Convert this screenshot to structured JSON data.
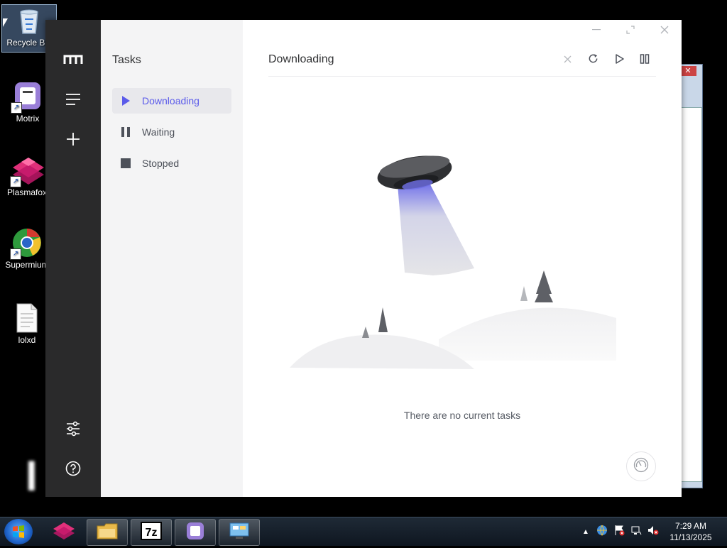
{
  "desktop": {
    "icons": [
      {
        "label": "Recycle Bin",
        "icon": "recycle-bin-icon"
      },
      {
        "label": "Motrix",
        "icon": "motrix-icon"
      },
      {
        "label": "Plasmafox",
        "icon": "plasmafox-icon"
      },
      {
        "label": "Supermium",
        "icon": "supermium-icon"
      },
      {
        "label": "lolxd",
        "icon": "document-icon"
      }
    ]
  },
  "app": {
    "rail": {
      "logo_icon": "motrix-logo-icon",
      "menu_icon": "menu-icon",
      "add_icon": "plus-icon",
      "settings_icon": "sliders-icon",
      "help_icon": "help-circle-icon"
    },
    "sidebar": {
      "title": "Tasks",
      "items": [
        {
          "label": "Downloading",
          "icon": "play-icon",
          "active": true
        },
        {
          "label": "Waiting",
          "icon": "pause-icon",
          "active": false
        },
        {
          "label": "Stopped",
          "icon": "stop-icon",
          "active": false
        }
      ]
    },
    "main": {
      "heading": "Downloading",
      "toolbar": [
        "close-icon",
        "refresh-icon",
        "play-icon",
        "pause-icon"
      ],
      "empty_message": "There are no current tasks"
    },
    "colors": {
      "rail_bg": "#2a2a2b",
      "sidebar_bg": "#f4f4f5",
      "accent": "#5b5bea"
    }
  },
  "taskbar": {
    "pinned": [
      "windows-start-icon",
      "plasmafox-icon",
      "file-explorer-icon",
      "7zip-icon",
      "motrix-icon",
      "control-panel-icon"
    ],
    "clock": {
      "time": "7:29 AM",
      "date": "11/13/2025"
    }
  }
}
